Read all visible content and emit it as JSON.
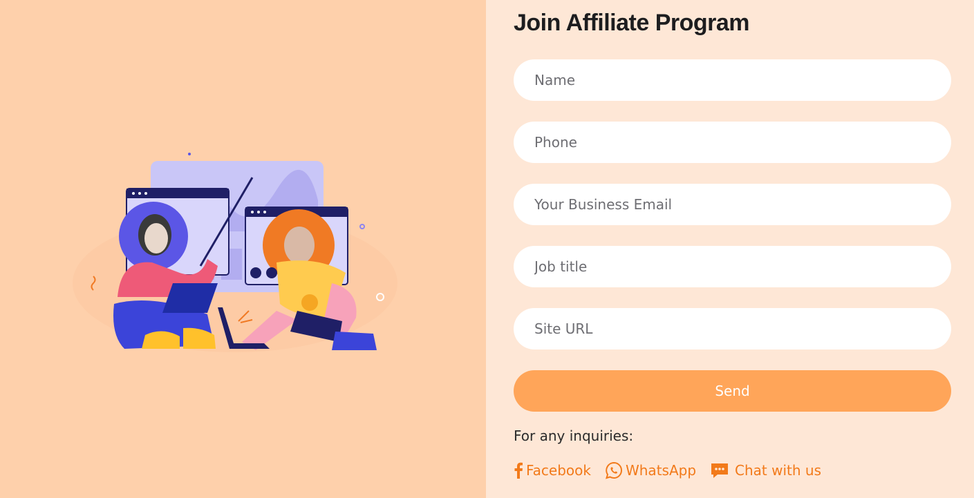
{
  "form": {
    "title": "Join Affiliate Program",
    "fields": {
      "name_placeholder": "Name",
      "phone_placeholder": "Phone",
      "email_placeholder": "Your Business Email",
      "job_placeholder": "Job title",
      "site_placeholder": "Site URL"
    },
    "send_label": "Send"
  },
  "contacts": {
    "prompt": "For any inquiries:",
    "facebook_label": "Facebook",
    "whatsapp_label": "WhatsApp",
    "chat_label": "Chat with us"
  },
  "colors": {
    "left_bg": "#fed0ab",
    "right_bg": "#fee7d6",
    "accent": "#ffa559",
    "link": "#f27a1a"
  },
  "icons": [
    "facebook-icon",
    "whatsapp-icon",
    "chat-icon",
    "video-call-illustration"
  ]
}
